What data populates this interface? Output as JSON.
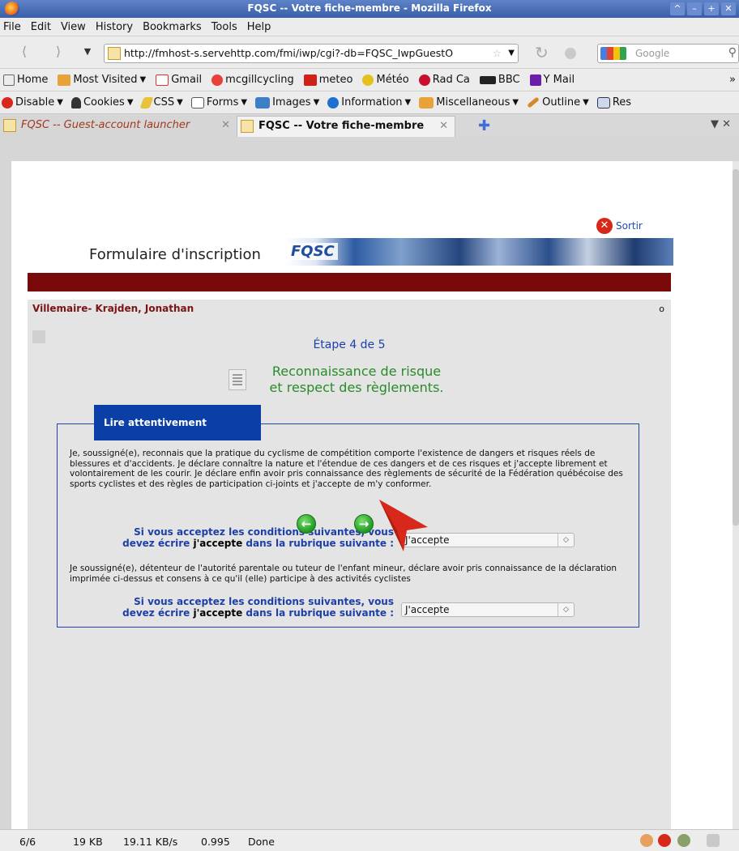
{
  "window": {
    "title": "FQSC -- Votre fiche-membre - Mozilla Firefox"
  },
  "menu": [
    "File",
    "Edit",
    "View",
    "History",
    "Bookmarks",
    "Tools",
    "Help"
  ],
  "nav": {
    "url": "http://fmhost-s.servehttp.com/fmi/iwp/cgi?-db=FQSC_IwpGuestO",
    "search_placeholder": "Google"
  },
  "bookmarks": [
    "Home",
    "Most Visited",
    "Gmail",
    "mcgillcycling",
    "meteo",
    "Météo",
    "Rad Ca",
    "BBC",
    "Y Mail"
  ],
  "devbar": [
    "Disable",
    "Cookies",
    "CSS",
    "Forms",
    "Images",
    "Information",
    "Miscellaneous",
    "Outline",
    "Res"
  ],
  "tabs": [
    {
      "label": "FQSC -- Guest-account launcher"
    },
    {
      "label": "FQSC -- Votre fiche-membre"
    }
  ],
  "page": {
    "sortir": "Sortir",
    "form_title": "Formulaire d'inscription",
    "banner_text": "FQSC",
    "member_name": "Villemaire- Krajden, Jonathan",
    "member_mark": "o",
    "step": "Étape 4 de 5",
    "heading_line1": "Reconnaissance de risque",
    "heading_line2": "et respect des règlements.",
    "legend": "Lire attentivement",
    "para1": "Je, soussigné(e), reconnais que la pratique du cyclisme de compétition comporte l'existence de dangers et risques réels de blessures et d'accidents. Je déclare connaître la nature et l'étendue de ces dangers et de ces risques et j'accepte librement et volontairement de les courir. Je déclare enfin avoir pris connaissance des règlements de sécurité de la Fédération québécoise des sports cyclistes et des règles de participation ci-joints et j'accepte de m'y conformer.",
    "question_line1": "Si vous acceptez les conditions suivantes, vous",
    "question_pre": "devez écrire",
    "question_bold": "j'accepte",
    "question_post": "dans la rubrique suivante :",
    "select1_value": "J'accepte",
    "para2": "Je soussigné(e), détenteur de l'autorité parentale ou tuteur de l'enfant mineur, déclare avoir pris connaissance de la déclaration imprimée ci-dessus et consens à ce qu'il (elle) participe à des activités cyclistes",
    "select2_value": "J'accepte"
  },
  "status": {
    "count": "6/6",
    "size": "19 KB",
    "speed": "19.11 KB/s",
    "time": "0.995",
    "state": "Done"
  },
  "colors": {
    "accent_blue": "#1d3fa8",
    "dark_red": "#7a0a0a",
    "green": "#2a8a2a"
  }
}
